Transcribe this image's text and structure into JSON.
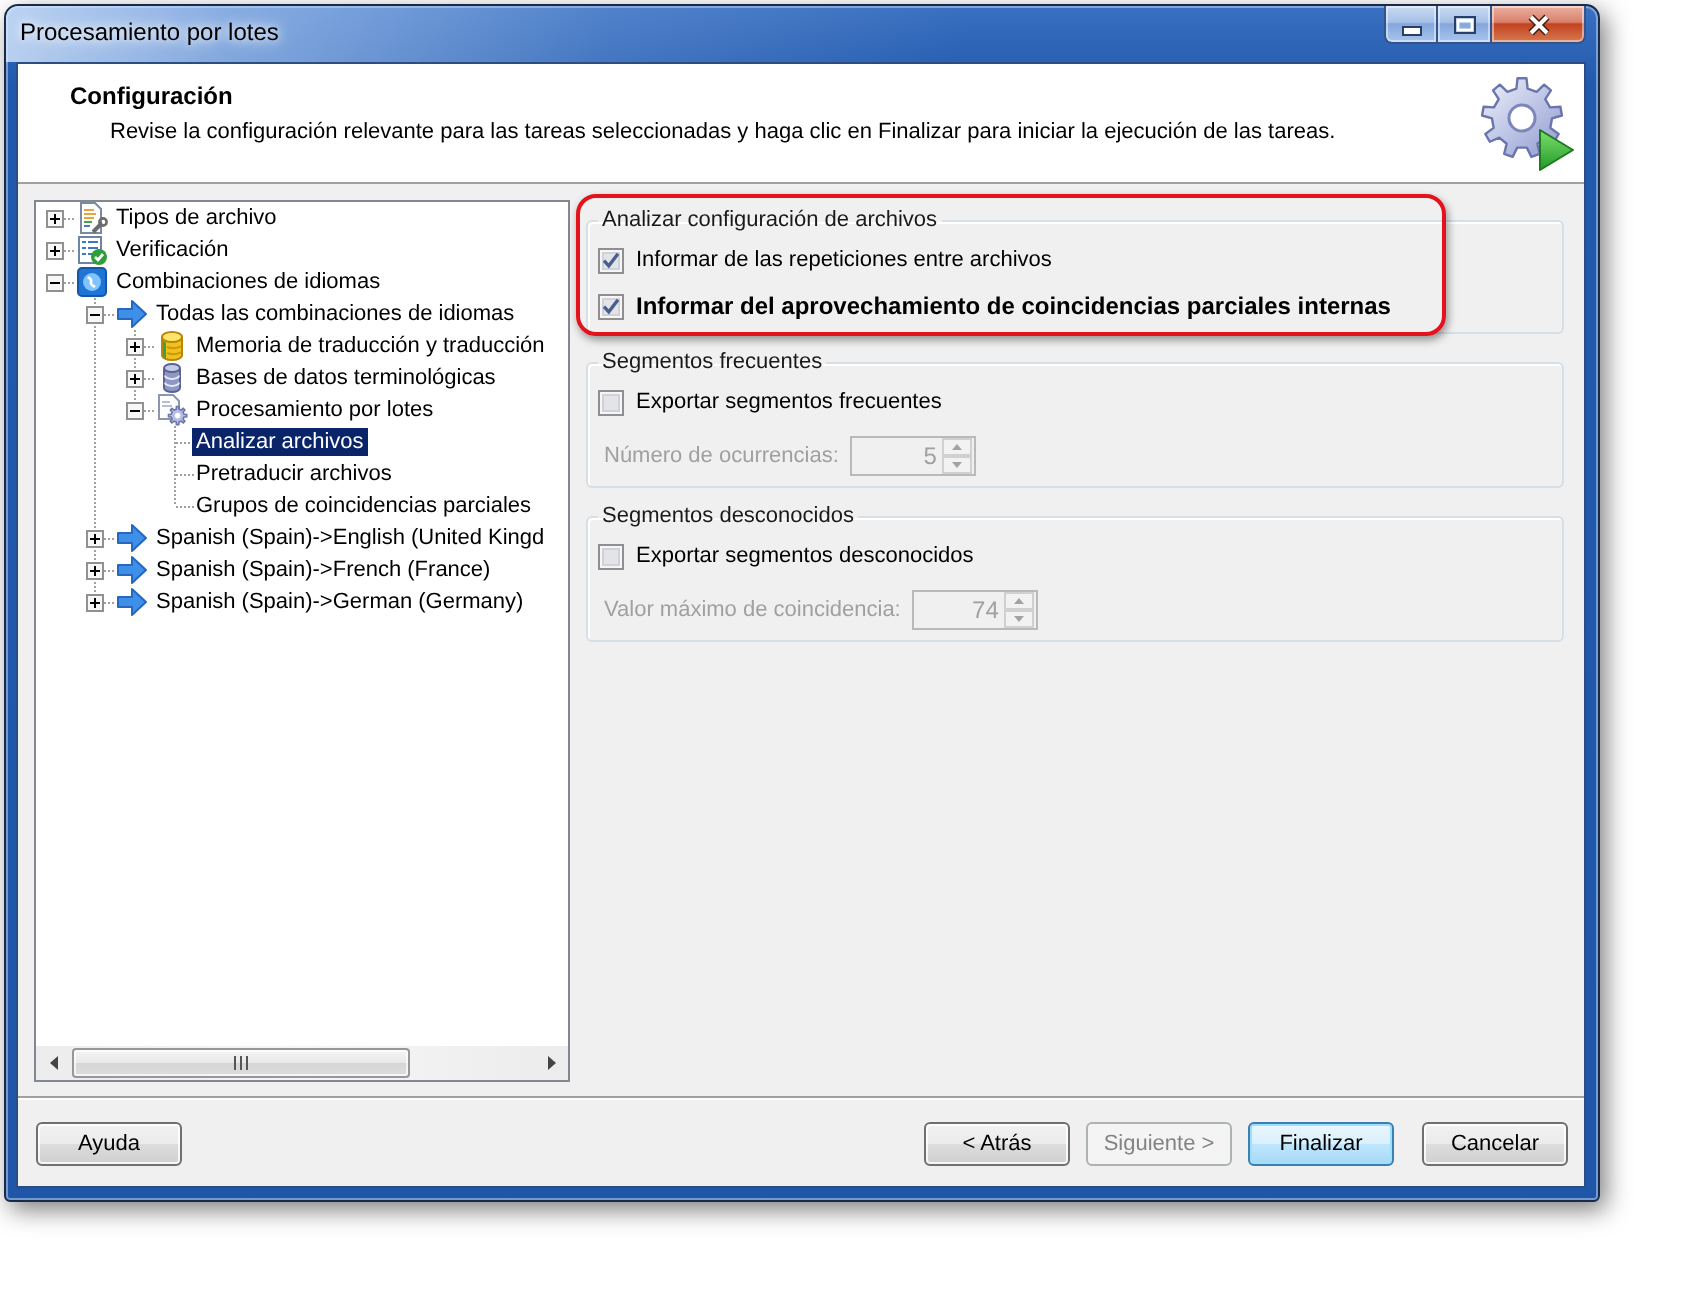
{
  "window": {
    "title": "Procesamiento por lotes"
  },
  "header": {
    "title": "Configuración",
    "description": "Revise la configuración relevante para las tareas seleccionadas y haga clic en Finalizar para iniciar la ejecución de las tareas."
  },
  "tree": [
    {
      "label": "Tipos de archivo",
      "kind": "file-types",
      "expanded": false,
      "selected": false
    },
    {
      "label": "Verificación",
      "kind": "verification",
      "expanded": false,
      "selected": false
    },
    {
      "label": "Combinaciones de idiomas",
      "kind": "languages",
      "expanded": true,
      "selected": false,
      "children": [
        {
          "label": "Todas las combinaciones de idiomas",
          "kind": "language-pair",
          "expanded": true,
          "selected": false,
          "children": [
            {
              "label": "Memoria de traducción y traducción",
              "kind": "memory",
              "expanded": false,
              "selected": false
            },
            {
              "label": "Bases de datos terminológicas",
              "kind": "termbase",
              "expanded": false,
              "selected": false
            },
            {
              "label": "Procesamiento por lotes",
              "kind": "batch",
              "expanded": true,
              "selected": false,
              "children": [
                {
                  "label": "Analizar archivos",
                  "kind": "task",
                  "selected": true
                },
                {
                  "label": "Pretraducir archivos",
                  "kind": "task",
                  "selected": false
                },
                {
                  "label": "Grupos de coincidencias parciales",
                  "kind": "task",
                  "selected": false
                }
              ]
            }
          ]
        },
        {
          "label": "Spanish (Spain)->English (United Kingd",
          "kind": "language-pair",
          "expanded": false,
          "selected": false
        },
        {
          "label": "Spanish (Spain)->French (France)",
          "kind": "language-pair",
          "expanded": false,
          "selected": false
        },
        {
          "label": "Spanish (Spain)->German (Germany)",
          "kind": "language-pair",
          "expanded": false,
          "selected": false
        }
      ]
    }
  ],
  "options": {
    "groups": [
      {
        "title": "Analizar configuración de archivos",
        "highlighted": true,
        "checkboxes": [
          {
            "label": "Informar de las repeticiones entre archivos",
            "checked": true,
            "bold": false
          },
          {
            "label": "Informar del aprovechamiento de coincidencias parciales internas",
            "checked": true,
            "bold": true
          }
        ]
      },
      {
        "title": "Segmentos frecuentes",
        "highlighted": false,
        "checkboxes": [
          {
            "label": "Exportar segmentos frecuentes",
            "checked": false,
            "bold": false
          }
        ],
        "number_field": {
          "label": "Número de ocurrencias:",
          "value": "5",
          "disabled": true
        }
      },
      {
        "title": "Segmentos desconocidos",
        "highlighted": false,
        "checkboxes": [
          {
            "label": "Exportar segmentos desconocidos",
            "checked": false,
            "bold": false
          }
        ],
        "number_field": {
          "label": "Valor máximo de coincidencia:",
          "value": "74",
          "disabled": true
        }
      }
    ]
  },
  "footer": {
    "help_button": {
      "label": "Ayuda",
      "disabled": false,
      "default": false
    },
    "buttons": [
      {
        "label": "< Atrás",
        "disabled": false,
        "default": false
      },
      {
        "label": "Siguiente >",
        "disabled": true,
        "default": false
      },
      {
        "label": "Finalizar",
        "disabled": false,
        "default": true
      },
      {
        "label": "Cancelar",
        "disabled": false,
        "default": false
      }
    ]
  }
}
